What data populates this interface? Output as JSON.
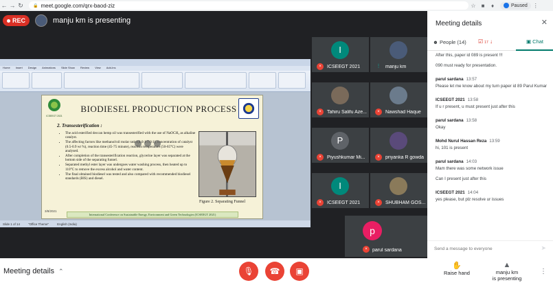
{
  "browser": {
    "url": "meet.google.com/qrx-baod-ziz",
    "profile_label": "Paused"
  },
  "meeting": {
    "rec_label": "REC",
    "presenting_title": "manju km is presenting"
  },
  "slide": {
    "title": "BIODIESEL PRODUCTION PROCESS",
    "logo_text": "ICSEEGT 2021",
    "subheading": "2. Transesterification :",
    "bullets": [
      "The acid esterified deccan hemp oil was transesterified with the use of NaOCH₃ as alkaline catalyst.",
      "The affecting factors like methanol/oil molar ratio (4.0:1-7.0:1), concentration of catalyst (0.5-0.9 wt %), reaction time (45-75 minute), reaction temperature (50-65°C) were analysed.",
      "After completion of the transesterification reaction, glycerine layer was separated at the bottom side of the separating funnel.",
      "Separated methyl ester layer was undergoes water washing process, then heated up to 110°C to remove the excess alcohol and water content.",
      "The final obtained biodiesel was tested and also compared with recommended biodiesel standards (BIS) and diesel."
    ],
    "caption": "Figure 2. Separating Funnel",
    "date": "3/8/2021",
    "footer": "International Conference on Sustainable Energy, Environment and Green Technologies (ICSEEGT 2021)",
    "ribbon_tabs": [
      "Home",
      "Insert",
      "Design",
      "Animations",
      "Slide Show",
      "Review",
      "View",
      "Add-Ins"
    ],
    "statusbar": [
      "Slide 1 of 14",
      "\"Office Theme\"",
      "English (India)"
    ]
  },
  "participants": [
    {
      "name": "ICSEEGT 2021",
      "initial": "I",
      "color": "#00897b",
      "mic_muted": true
    },
    {
      "name": "manju km",
      "initial": "",
      "color": "#4a5b78",
      "mic_muted": false
    },
    {
      "name": "Tahiru Salifu Aze...",
      "initial": "",
      "color": "#7a6a5a",
      "mic_muted": true
    },
    {
      "name": "Nawshad Haque",
      "initial": "",
      "color": "#6b7b8c",
      "mic_muted": true
    },
    {
      "name": "Piyushkumar Mi...",
      "initial": "P",
      "color": "#5f6368",
      "mic_muted": true
    },
    {
      "name": "priyanka R gowda",
      "initial": "",
      "color": "#5a4a7a",
      "mic_muted": true
    },
    {
      "name": "ICSEEGT 2021",
      "initial": "I",
      "color": "#00897b",
      "mic_muted": true
    },
    {
      "name": "SHUBHAM GOS...",
      "initial": "",
      "color": "#8a7a5a",
      "mic_muted": true
    }
  ],
  "featured": {
    "name": "parul sardana",
    "initial": "p",
    "color": "#e91e63"
  },
  "bottom": {
    "meeting_details": "Meeting details",
    "raise_hand": "Raise hand",
    "presenting_label_1": "manju km",
    "presenting_label_2": "is presenting"
  },
  "panel": {
    "title": "Meeting details",
    "tab_people": "People (14)",
    "tab_activity_badge": "17",
    "tab_chat": "Chat",
    "send_placeholder": "Send a message to everyone",
    "messages": [
      {
        "author": "",
        "time": "",
        "lines": [
          "After this, paper id 089 is present !!!",
          "090 must ready for presentation."
        ]
      },
      {
        "author": "parul sardana",
        "time": "13:57",
        "lines": [
          "Please let me know about my turn paper id  89 Parul Kumar"
        ]
      },
      {
        "author": "ICSEEGT 2021",
        "time": "13:58",
        "lines": [
          "If u r present, u must present just after this"
        ]
      },
      {
        "author": "parul sardana",
        "time": "13:58",
        "lines": [
          "Okay"
        ]
      },
      {
        "author": "Mohd Nurul Hassan Reza",
        "time": "13:59",
        "lines": [
          "hi, 101 is present"
        ]
      },
      {
        "author": "parul sardana",
        "time": "14:03",
        "lines": [
          "Mam there was some network issue",
          "Can I present just after this"
        ]
      },
      {
        "author": "ICSEEGT 2021",
        "time": "14:04",
        "lines": [
          "yes please, but plz resolve ur issues"
        ]
      }
    ]
  }
}
